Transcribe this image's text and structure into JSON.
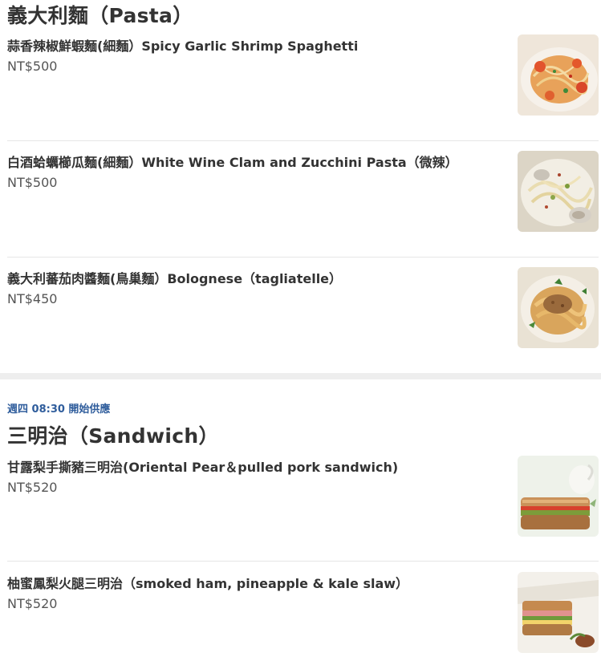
{
  "pasta": {
    "title": "義大利麵（Pasta）",
    "items": [
      {
        "name": "蒜香辣椒鮮蝦麵(細麵）Spicy Garlic Shrimp Spaghetti",
        "price": "NT$500",
        "image": "shrimp-spaghetti-photo"
      },
      {
        "name": "白酒蛤蠣櫛瓜麵(細麵）White Wine Clam and Zucchini Pasta（微辣）",
        "price": "NT$500",
        "image": "clam-zucchini-pasta-photo"
      },
      {
        "name": "義大利蕃茄肉醬麵(鳥巢麵）Bolognese（tagliatelle）",
        "price": "NT$450",
        "image": "bolognese-photo"
      }
    ]
  },
  "sandwich": {
    "availability": "週四 08:30 開始供應",
    "title": "三明治（Sandwich）",
    "items": [
      {
        "name": "甘露梨手撕豬三明治(Oriental Pear＆pulled pork sandwich)",
        "price": "NT$520",
        "image": "pear-pork-sandwich-photo"
      },
      {
        "name": "柚蜜鳳梨火腿三明治（smoked ham, pineapple & kale slaw）",
        "price": "NT$520",
        "image": "ham-pineapple-sandwich-photo"
      }
    ]
  },
  "colors": {
    "accent": "#2f5d9c",
    "text": "#333333",
    "divider": "#e6e6e6",
    "band": "#eeeeee"
  }
}
